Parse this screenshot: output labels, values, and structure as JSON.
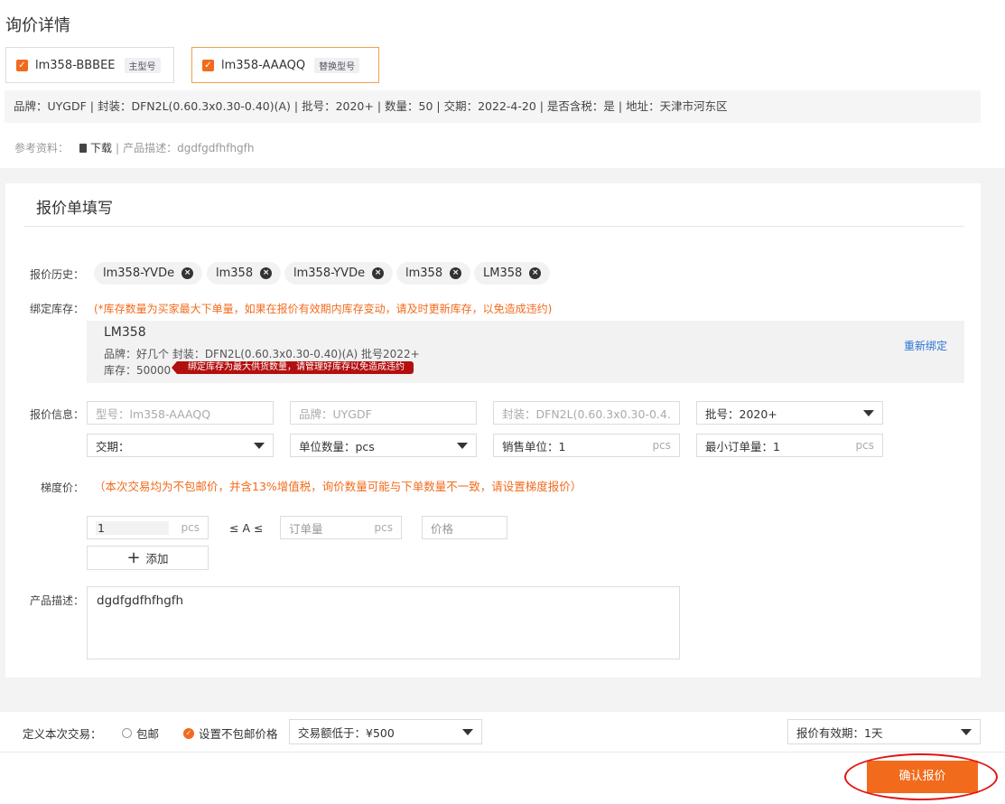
{
  "title": "询价详情",
  "models": [
    {
      "name": "lm358-BBBEE",
      "tag": "主型号"
    },
    {
      "name": "lm358-AAAQQ",
      "tag": "替换型号"
    }
  ],
  "check_mark": "✓",
  "inquiry_info": "品牌：UYGDF | 封装：DFN2L(0.60.3x0.30-0.40)(A) | 批号：2020+ | 数量：50 | 交期：2022-4-20 | 是否含税：是 | 地址：天津市河东区",
  "reference": {
    "label": "参考资料：",
    "download": "下载",
    "sep": "|",
    "desc": "产品描述：dgdfgdfhfhgfh"
  },
  "form_title": "报价单填写",
  "history": {
    "label": "报价历史：",
    "items": [
      "lm358-YVDe",
      "lm358",
      "lm358-YVDe",
      "lm358",
      "LM358"
    ]
  },
  "close_glyph": "×",
  "stock": {
    "label": "绑定库存：",
    "warning": "(*库存数量为买家最大下单量，如果在报价有效期内库存变动，请及时更新库存，以免造成违约)",
    "name": "LM358",
    "detail": "品牌：好几个   封装：DFN2L(0.60.3x0.30-0.40)(A)   批号2022+",
    "qty": "库存：50000",
    "tip": "绑定库存为最大供货数量，请管理好库存以免造成违约",
    "rebind": "重新绑定"
  },
  "quote": {
    "label": "报价信息：",
    "model": "型号：lm358-AAAQQ",
    "brand": "品牌：UYGDF",
    "package": "封装：DFN2L(0.60.3x0.30-0.4...",
    "batch": "批号：2020+",
    "delivery": "交期：",
    "unit_qty": "单位数量：pcs",
    "sale_unit": "销售单位：1",
    "sale_unit_suffix": "pcs",
    "moq": "最小订单量：1",
    "moq_suffix": "pcs"
  },
  "tier": {
    "label": "梯度价：",
    "note": "（本次交易均为不包邮价，并含13%增值税，询价数量可能与下单数量不一致，请设置梯度报价）",
    "min_value": "1",
    "min_unit": "pcs",
    "between": "≤ A ≤",
    "order_qty_placeholder": "订单量",
    "order_qty_unit": "pcs",
    "price_placeholder": "价格",
    "add_label": "添加",
    "plus_glyph": "+"
  },
  "product_desc": {
    "label": "产品描述：",
    "value": "dgdfgdfhfhgfh"
  },
  "footer": {
    "define_label": "定义本次交易：",
    "option_free": "包邮",
    "option_set": "设置不包邮价格",
    "threshold": "交易额低于：¥500",
    "validity": "报价有效期：1天",
    "confirm": "确认报价"
  },
  "colors": {
    "accent": "#f26b1d",
    "link": "#2b73d6",
    "warn_tip": "#b30f0f",
    "highlight": "#e01616"
  }
}
